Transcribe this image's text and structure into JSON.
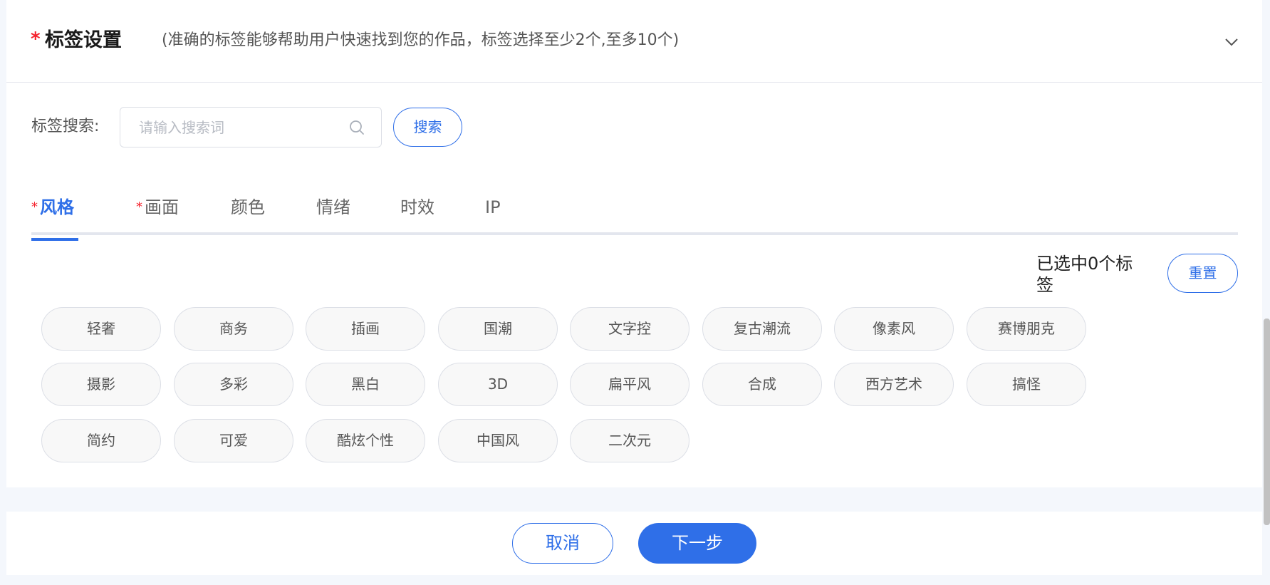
{
  "header": {
    "required_mark": "*",
    "title": "标签设置",
    "hint": "(准确的标签能够帮助用户快速找到您的作品，标签选择至少2个,至多10个)"
  },
  "search": {
    "label": "标签搜索:",
    "placeholder": "请输入搜索词",
    "value": "",
    "button_label": "搜索"
  },
  "tabs": [
    {
      "label": "风格",
      "required": true,
      "active": true
    },
    {
      "label": "画面",
      "required": true,
      "active": false
    },
    {
      "label": "颜色",
      "required": false,
      "active": false
    },
    {
      "label": "情绪",
      "required": false,
      "active": false
    },
    {
      "label": "时效",
      "required": false,
      "active": false
    },
    {
      "label": "IP",
      "required": false,
      "active": false
    }
  ],
  "tab_required_mark": "*",
  "selection": {
    "count_text": "已选中0个标签",
    "reset_label": "重置"
  },
  "tags": [
    [
      "轻奢",
      "商务",
      "插画",
      "国潮",
      "文字控",
      "复古潮流",
      "像素风",
      "赛博朋克"
    ],
    [
      "摄影",
      "多彩",
      "黑白",
      "3D",
      "扁平风",
      "合成",
      "西方艺术",
      "搞怪"
    ],
    [
      "简约",
      "可爱",
      "酷炫个性",
      "中国风",
      "二次元"
    ]
  ],
  "footer": {
    "cancel_label": "取消",
    "next_label": "下一步"
  },
  "colors": {
    "accent": "#2f6fe8",
    "required": "#f5222d",
    "page_bg": "#f4f7fc",
    "chip_bg": "#f8f8f8"
  }
}
